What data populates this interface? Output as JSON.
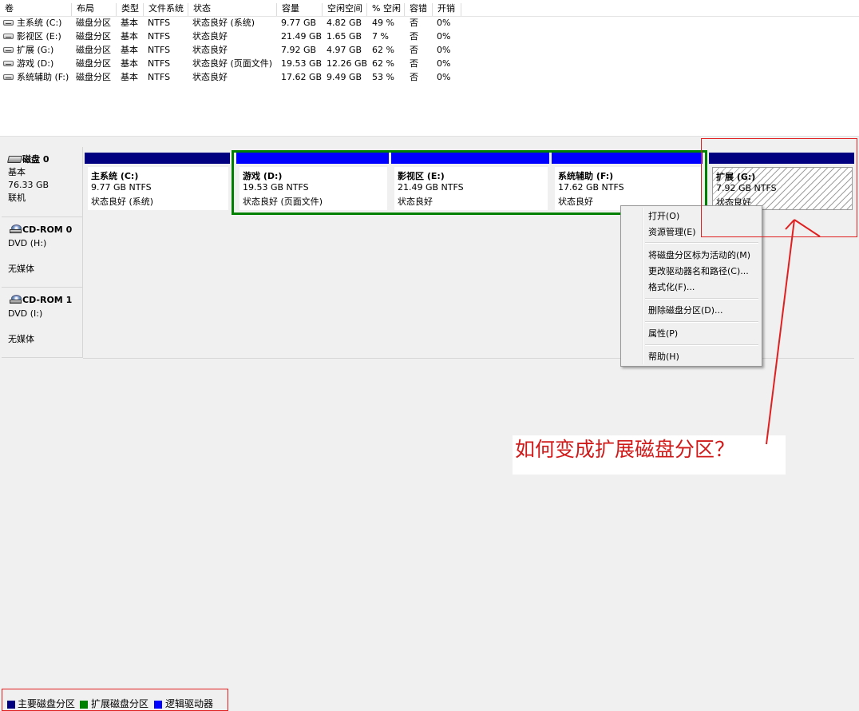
{
  "volume_list": {
    "columns": [
      "卷",
      "布局",
      "类型",
      "文件系统",
      "状态",
      "容量",
      "空闲空间",
      "% 空闲",
      "容错",
      "开销"
    ],
    "rows": [
      {
        "volume": "主系统 (C:)",
        "layout": "磁盘分区",
        "type": "基本",
        "fs": "NTFS",
        "status": "状态良好 (系统)",
        "capacity": "9.77 GB",
        "free": "4.82 GB",
        "pct": "49 %",
        "fault": "否",
        "overhead": "0%"
      },
      {
        "volume": "影视区 (E:)",
        "layout": "磁盘分区",
        "type": "基本",
        "fs": "NTFS",
        "status": "状态良好",
        "capacity": "21.49 GB",
        "free": "1.65 GB",
        "pct": "7 %",
        "fault": "否",
        "overhead": "0%"
      },
      {
        "volume": "扩展 (G:)",
        "layout": "磁盘分区",
        "type": "基本",
        "fs": "NTFS",
        "status": "状态良好",
        "capacity": "7.92 GB",
        "free": "4.97 GB",
        "pct": "62 %",
        "fault": "否",
        "overhead": "0%"
      },
      {
        "volume": "游戏 (D:)",
        "layout": "磁盘分区",
        "type": "基本",
        "fs": "NTFS",
        "status": "状态良好 (页面文件)",
        "capacity": "19.53 GB",
        "free": "12.26 GB",
        "pct": "62 %",
        "fault": "否",
        "overhead": "0%"
      },
      {
        "volume": "系统辅助 (F:)",
        "layout": "磁盘分区",
        "type": "基本",
        "fs": "NTFS",
        "status": "状态良好",
        "capacity": "17.62 GB",
        "free": "9.49 GB",
        "pct": "53 %",
        "fault": "否",
        "overhead": "0%"
      }
    ]
  },
  "disks": [
    {
      "title": "磁盘 0",
      "lines": [
        "基本",
        "76.33 GB",
        "联机"
      ],
      "icon": "hard-disk-icon"
    },
    {
      "title": "CD-ROM 0",
      "lines": [
        "DVD (H:)",
        "",
        "无媒体"
      ],
      "icon": "cdrom-icon"
    },
    {
      "title": "CD-ROM 1",
      "lines": [
        "DVD (I:)",
        "",
        "无媒体"
      ],
      "icon": "cdrom-icon"
    }
  ],
  "partitions": [
    {
      "name": "主系统  (C:)",
      "size": "9.77 GB NTFS",
      "status": "状态良好 (系统)",
      "kind": "primary"
    },
    {
      "name": "游戏  (D:)",
      "size": "19.53 GB NTFS",
      "status": "状态良好 (页面文件)",
      "kind": "logical"
    },
    {
      "name": "影视区  (E:)",
      "size": "21.49 GB NTFS",
      "status": "状态良好",
      "kind": "logical"
    },
    {
      "name": "系统辅助  (F:)",
      "size": "17.62 GB NTFS",
      "status": "状态良好",
      "kind": "logical"
    },
    {
      "name": "扩展  (G:)",
      "size": "7.92 GB NTFS",
      "status": "状态良好",
      "kind": "primary",
      "selected": true
    }
  ],
  "context_menu": {
    "items": [
      "打开(O)",
      "资源管理(E)",
      "将磁盘分区标为活动的(M)",
      "更改驱动器名和路径(C)...",
      "格式化(F)...",
      "删除磁盘分区(D)...",
      "属性(P)",
      "帮助(H)"
    ]
  },
  "annotation": {
    "question": "如何变成扩展磁盘分区？",
    "color": "#d01a1a"
  },
  "legend": [
    {
      "label": "主要磁盘分区",
      "color": "#000080"
    },
    {
      "label": "扩展磁盘分区",
      "color": "#008000"
    },
    {
      "label": "逻辑驱动器",
      "color": "#0000ff"
    }
  ]
}
